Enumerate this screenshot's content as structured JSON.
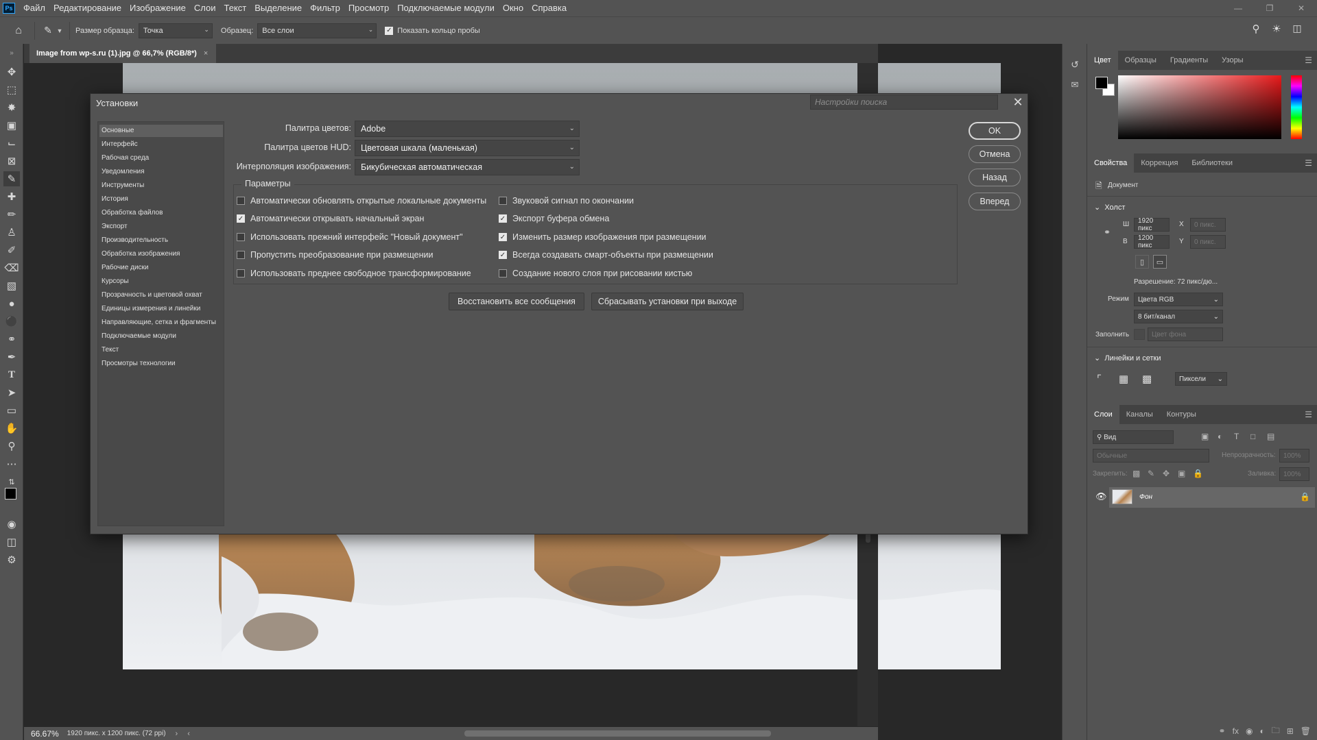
{
  "menubar": {
    "logo": "Ps",
    "items": [
      "Файл",
      "Редактирование",
      "Изображение",
      "Слои",
      "Текст",
      "Выделение",
      "Фильтр",
      "Просмотр",
      "Подключаемые модули",
      "Окно",
      "Справка"
    ]
  },
  "options_bar": {
    "sample_size_label": "Размер образца:",
    "sample_size_value": "Точка",
    "sample_label": "Образец:",
    "sample_value": "Все слои",
    "show_ring_label": "Показать кольцо пробы",
    "show_ring_checked": true
  },
  "document": {
    "tab_title": "Image from wp-s.ru (1).jpg @ 66,7% (RGB/8*)",
    "close_glyph": "×"
  },
  "status_bar": {
    "zoom": "66.67%",
    "info": "1920 пикс. x 1200 пикс. (72 ppi)"
  },
  "color_panel": {
    "tabs": [
      "Цвет",
      "Образцы",
      "Градиенты",
      "Узоры"
    ],
    "active_tab": 0,
    "accent": "#e8191a"
  },
  "properties_panel": {
    "tabs": [
      "Свойства",
      "Коррекция",
      "Библиотеки"
    ],
    "doc_label": "Документ",
    "canvas_section": "Холст",
    "w_label": "Ш",
    "w_value": "1920 пикс",
    "h_label": "В",
    "h_value": "1200 пикс",
    "x_label": "X",
    "x_placeholder": "0 пикс.",
    "y_label": "Y",
    "y_placeholder": "0 пикс.",
    "resolution": "Разрешение: 72 пикс/дю...",
    "mode_label": "Режим",
    "mode_value": "Цвета RGB",
    "depth_value": "8 бит/канал",
    "fill_label": "Заполнить",
    "fill_value": "Цвет фона",
    "rulers_section": "Линейки и сетки",
    "units_value": "Пиксели"
  },
  "layers_panel": {
    "tabs": [
      "Слои",
      "Каналы",
      "Контуры"
    ],
    "search_placeholder": "Вид",
    "blend_mode": "Обычные",
    "opacity_label": "Непрозрачность:",
    "opacity_value": "100%",
    "lock_label": "Закрепить:",
    "fill_label": "Заливка:",
    "fill_value": "100%",
    "layers": [
      {
        "name": "Фон",
        "visible": true,
        "locked": true
      }
    ]
  },
  "dialog": {
    "title": "Установки",
    "search_placeholder": "Настройки поиска",
    "nav_items": [
      "Основные",
      "Интерфейс",
      "Рабочая среда",
      "Уведомления",
      "Инструменты",
      "История",
      "Обработка файлов",
      "Экспорт",
      "Производительность",
      "Обработка изображения",
      "Рабочие диски",
      "Курсоры",
      "Прозрачность и цветовой охват",
      "Единицы измерения и линейки",
      "Направляющие, сетка и фрагменты",
      "Подключаемые модули",
      "Текст",
      "Просмотры технологии"
    ],
    "nav_active": 0,
    "color_picker_label": "Палитра цветов:",
    "color_picker_value": "Adobe",
    "hud_picker_label": "Палитра цветов HUD:",
    "hud_picker_value": "Цветовая шкала (маленькая)",
    "interpolation_label": "Интерполяция изображения:",
    "interpolation_value": "Бикубическая автоматическая",
    "params_legend": "Параметры",
    "options_left": [
      {
        "label": "Автоматически обновлять открытые локальные документы",
        "checked": false
      },
      {
        "label": "Автоматически открывать начальный экран",
        "checked": true
      },
      {
        "label": "Использовать прежний интерфейс \"Новый документ\"",
        "checked": false
      },
      {
        "label": "Пропустить преобразование при размещении",
        "checked": false
      },
      {
        "label": "Использовать преднее свободное трансформирование",
        "checked": false
      }
    ],
    "options_right": [
      {
        "label": "Звуковой сигнал по окончании",
        "checked": false
      },
      {
        "label": "Экспорт буфера обмена",
        "checked": true
      },
      {
        "label": "Изменить размер изображения при размещении",
        "checked": true
      },
      {
        "label": "Всегда создавать смарт-объекты при размещении",
        "checked": true
      },
      {
        "label": "Создание нового слоя при рисовании кистью",
        "checked": false
      }
    ],
    "reset_messages_button": "Восстановить все сообщения",
    "reset_prefs_button": "Сбрасывать установки при выходе",
    "ok_button": "OK",
    "cancel_button": "Отмена",
    "prev_button": "Назад",
    "next_button": "Вперед"
  }
}
